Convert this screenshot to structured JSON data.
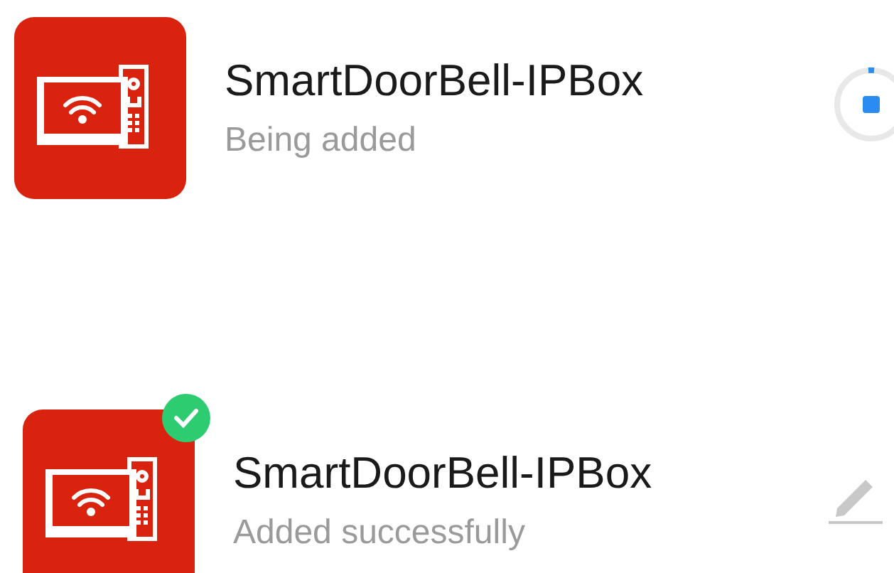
{
  "devices": [
    {
      "name": "SmartDoorBell-IPBox",
      "status": "Being added",
      "kind": "adding"
    },
    {
      "name": "SmartDoorBell-IPBox",
      "status": "Added successfully",
      "kind": "added"
    }
  ]
}
